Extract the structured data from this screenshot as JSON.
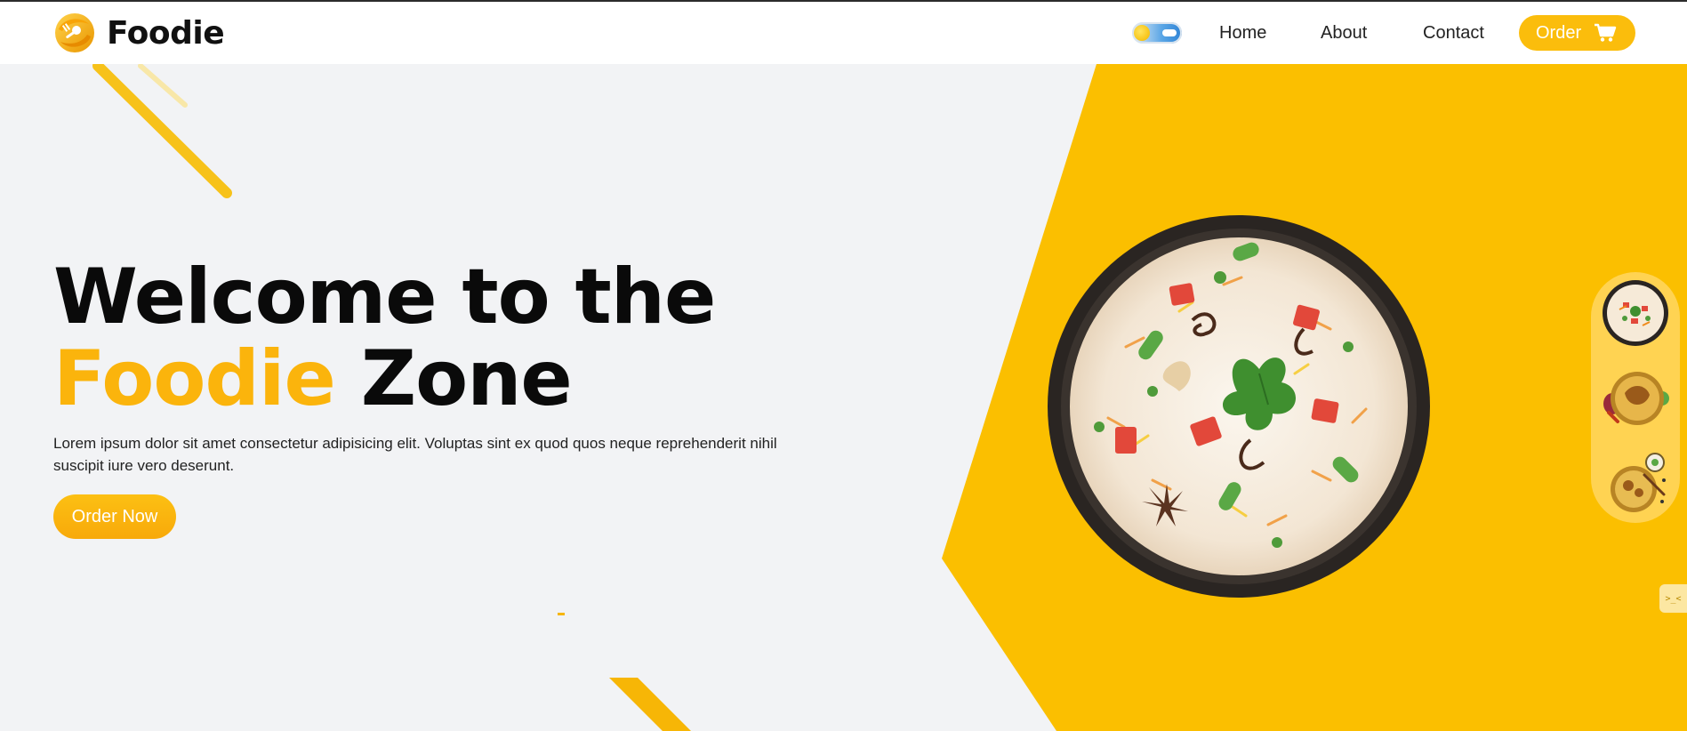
{
  "brand": {
    "name": "Foodie",
    "logo_icon": "spoon-fork-logo-icon"
  },
  "nav": {
    "theme_toggle": {
      "icon": "sun-cloud-toggle-icon",
      "state": "light"
    },
    "links": [
      "Home",
      "About",
      "Contact"
    ],
    "order_label": "Order",
    "order_icon": "shopping-cart-icon"
  },
  "hero": {
    "headline_line1": "Welcome to the",
    "headline_accent": "Foodie",
    "headline_rest": "Zone",
    "subtext": "Lorem ipsum dolor sit amet consectetur adipisicing elit. Voluptas sint ex quod quos neque reprehenderit nihil suscipit iure vero deserunt.",
    "cta_label": "Order Now",
    "image_icon": "biryani-plate-image"
  },
  "thumbnails": [
    {
      "icon": "biryani-thumbnail-image"
    },
    {
      "icon": "chicken-biryani-thumbnail-image"
    },
    {
      "icon": "biryani-spices-thumbnail-image"
    }
  ],
  "side_chip": {
    "label": ">_<",
    "icon": "side-chip-icon"
  },
  "colors": {
    "accent": "#fbbd0c",
    "hero_bg": "#fbbf00",
    "page_bg": "#f2f3f5",
    "text": "#0a0a0a"
  }
}
